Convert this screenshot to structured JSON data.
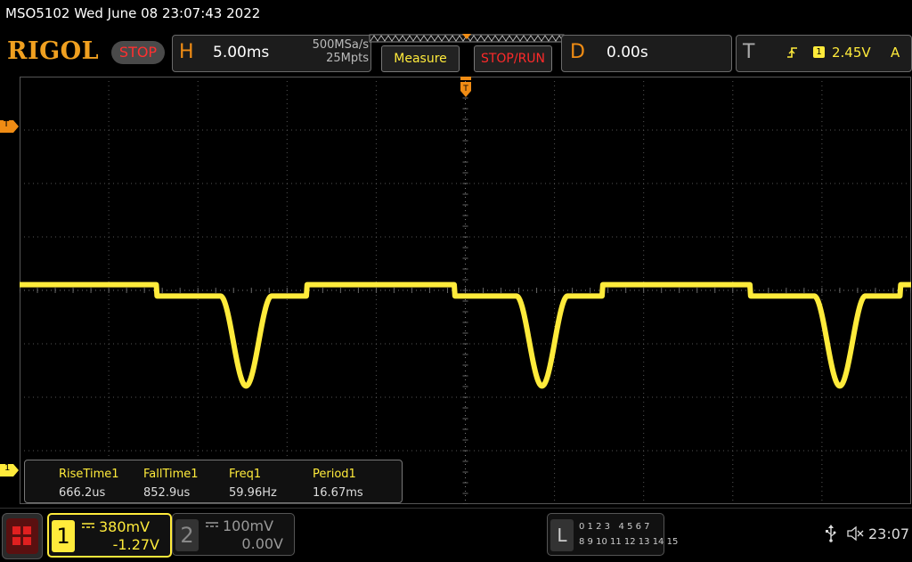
{
  "header": {
    "title": "MSO5102  Wed June 08 23:07:43 2022",
    "logo": "RIGOL",
    "status": "STOP"
  },
  "horizontal": {
    "letter": "H",
    "timebase": "5.00ms",
    "sample_rate": "500MSa/s",
    "memory_depth": "25Mpts"
  },
  "buttons": {
    "measure": "Measure",
    "stop_run": "STOP/RUN"
  },
  "delay": {
    "letter": "D",
    "value": "0.00s"
  },
  "trigger": {
    "letter": "T",
    "edge_icon": "rising-edge-icon",
    "source": "1",
    "level": "2.45V",
    "mode": "A",
    "marker_label": "T"
  },
  "channel_marker": "1",
  "measurements": [
    {
      "label": "RiseTime1",
      "value": "666.2us"
    },
    {
      "label": "FallTime1",
      "value": "852.9us"
    },
    {
      "label": "Freq1",
      "value": "59.96Hz"
    },
    {
      "label": "Period1",
      "value": "16.67ms"
    }
  ],
  "channels": {
    "ch1": {
      "num": "1",
      "scale": "380mV",
      "offset": "-1.27V",
      "color": "#ffeb3b",
      "coupling_icon": "dc-coupling-icon"
    },
    "ch2": {
      "num": "2",
      "scale": "100mV",
      "offset": "0.00V",
      "color": "#999999",
      "coupling_icon": "dc-coupling-icon"
    }
  },
  "logic": {
    "letter": "L",
    "row1": "0 1 2 3   4 5 6 7",
    "row2": "8 9 10 11 12 13 14 15"
  },
  "status_bar": {
    "usb_icon": "usb-icon",
    "sound_icon": "speaker-muted-icon",
    "clock": "23:07"
  },
  "colors": {
    "trace": "#ffeb3b",
    "accent": "#f08c14",
    "stop": "#ff2a2a"
  },
  "chart_data": {
    "type": "line",
    "title": "",
    "xlabel": "",
    "ylabel": "",
    "x_unit": "ms",
    "y_unit": "V",
    "time_per_div_ms": 5,
    "volts_per_div": 0.38,
    "xlim": [
      -25,
      25
    ],
    "ylim": [
      -1.52,
      1.52
    ],
    "grid": true,
    "baseline_levels_V": {
      "high": 0.04,
      "low": -0.04
    },
    "period_ms": 16.67,
    "pulses": [
      {
        "step_down_ms": -17.3,
        "dip_center_ms": -12.3,
        "dip_min_V": -0.68,
        "step_up_ms": -8.9
      },
      {
        "step_down_ms": -0.6,
        "dip_center_ms": 4.3,
        "dip_min_V": -0.68,
        "step_up_ms": 7.7
      },
      {
        "step_down_ms": 16.0,
        "dip_center_ms": 21.0,
        "dip_min_V": -0.68,
        "step_up_ms": 24.4
      }
    ],
    "dip_half_width_ms": 0.9
  }
}
